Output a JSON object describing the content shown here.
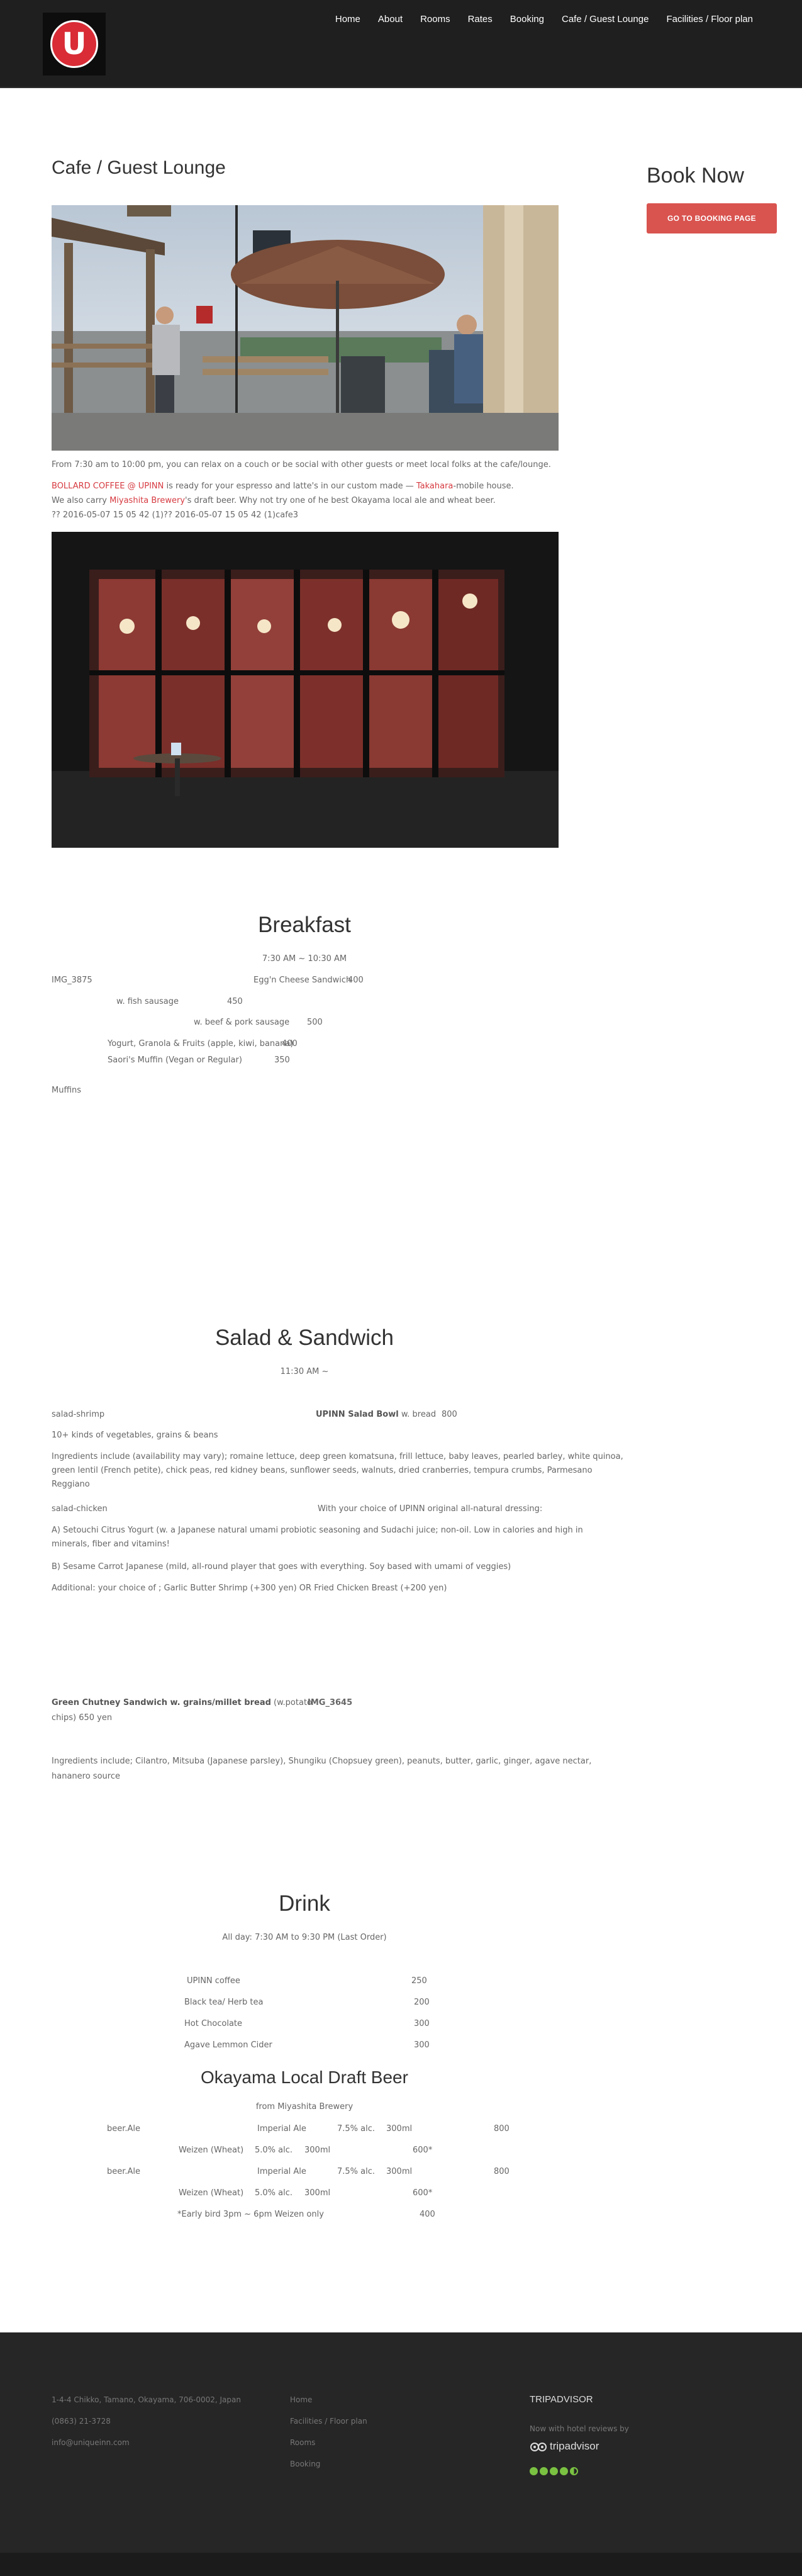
{
  "header": {
    "logo_letter": "U",
    "nav": [
      "Home",
      "About",
      "Rooms",
      "Rates",
      "Booking",
      "Cafe / Guest Lounge",
      "Facilities / Floor plan"
    ]
  },
  "page": {
    "title": "Cafe / Guest Lounge",
    "intro": "From 7:30 am to 10:00 pm, you can relax on a couch or be social with other guests or meet local folks at the cafe/lounge.",
    "line2_a": "BOLLARD COFFEE @ UPINN",
    "line2_b": " is ready for your espresso and latte's in our custom made — ",
    "line2_c": "Takahara",
    "line2_d": "-mobile house.",
    "line3_a": "We also carry ",
    "line3_b": "Miyashita Brewery",
    "line3_c": "'s draft beer. Why not try one of he best Okayama local ale and wheat beer.",
    "line4": "?? 2016-05-07 15 05 42 (1)?? 2016-05-07 15 05 42 (1)cafe3"
  },
  "sidebar": {
    "title": "Book Now",
    "button": "GO TO BOOKING PAGE"
  },
  "breakfast": {
    "title": "Breakfast",
    "hours": "7:30 AM ~ 10:30 AM",
    "img_label": "IMG_3875",
    "item1": "Egg'n Cheese Sandwich",
    "price1": "400",
    "item2": "w. fish sausage",
    "price2": "450",
    "item3": "w. beef & pork sausage",
    "price3": "500",
    "item4": "Yogurt, Granola & Fruits (apple, kiwi, banana)",
    "price4": "400",
    "item5": "Saori's Muffin (Vegan or Regular)",
    "price5": "350",
    "muffins": "Muffins"
  },
  "salad": {
    "title": "Salad & Sandwich",
    "hours": "11:30 AM ~",
    "img1": "salad-shrimp",
    "bowl": "UPINN Salad Bowl",
    "bowl_suffix": " w. bread",
    "bowl_price": "800",
    "veg": "10+ kinds of vegetables, grains & beans",
    "ingredients_1": "Ingredients include (availability may vary); romaine lettuce, deep green komatsuna, frill lettuce, baby leaves, pearled barley, white quinoa,",
    "ingredients_2": "green lentil (French petite), chick peas, red kidney beans, sunflower seeds, walnuts, dried cranberries, tempura crumbs, Parmesano",
    "ingredients_3": "Reggiano",
    "img2": "salad-chicken",
    "dressing": "With your choice of UPINN original all-natural dressing:",
    "opt_a_1": "A) Setouchi Citrus Yogurt (w. a Japanese natural umami probiotic seasoning and Sudachi juice; non-oil. Low in calories and high in",
    "opt_a_2": "minerals, fiber and vitamins!",
    "opt_b": "B) Sesame Carrot Japanese (mild, all-round player that goes with everything. Soy based with umami of veggies)",
    "additional": "Additional: your choice of ; Garlic Butter Shrimp (+300 yen) OR Fried Chicken Breast (+200 yen)",
    "gc_name": "Green Chutney Sandwich w. grains/millet bread",
    "gc_suffix": " (w.potato",
    "gc_img": "IMG_3645",
    "gc_line2": "chips)   650 yen",
    "gc_ing_1": "Ingredients include; Cilantro, Mitsuba (Japanese parsley), Shungiku (Chopsuey green), peanuts, butter, garlic, ginger, agave nectar,",
    "gc_ing_2": "hananero source"
  },
  "drink": {
    "title": "Drink",
    "hours": "All day: 7:30 AM to 9:30 PM (Last Order)",
    "items": [
      {
        "name": "UPINN coffee",
        "price": "250"
      },
      {
        "name": "Black tea/ Herb tea",
        "price": "200"
      },
      {
        "name": "Hot Chocolate",
        "price": "300"
      },
      {
        "name": "Agave Lemmon Cider",
        "price": "300"
      }
    ]
  },
  "beer": {
    "title": "Okayama Local Draft Beer",
    "from": "from Miyashita Brewery",
    "beer_label": "beer.Ale",
    "imperial": "Imperial Ale",
    "imperial_abv": "7.5% alc.",
    "imperial_vol": "300ml",
    "imperial_price": "800",
    "weizen": "Weizen (Wheat)",
    "weizen_abv": "5.0% alc.",
    "weizen_vol": "300ml",
    "weizen_price": "600*",
    "early": "*Early bird 3pm ~ 6pm   Weizen only",
    "early_price": "400"
  },
  "footer": {
    "address": "1-4-4 Chikko, Tamano, Okayama, 706-0002, Japan",
    "phone": "(0863) 21-3728",
    "email": "info@uniqueinn.com",
    "links": [
      "Home",
      "Facilities / Floor plan",
      "Rooms",
      "Booking"
    ],
    "ta_title": "TRIPADVISOR",
    "ta_text": "Now with hotel reviews by",
    "ta_brand": "tripadvisor"
  }
}
